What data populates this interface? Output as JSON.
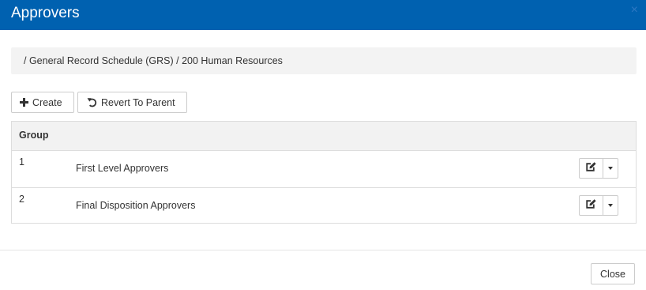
{
  "modal": {
    "title": "Approvers",
    "close_glyph": "×"
  },
  "breadcrumb": {
    "path": "/ General Record Schedule (GRS) / 200 Human Resources"
  },
  "toolbar": {
    "create_label": "Create",
    "revert_label": "Revert To Parent"
  },
  "table": {
    "columns": [
      "Group"
    ],
    "rows": [
      {
        "number": "1",
        "name": "First Level Approvers"
      },
      {
        "number": "2",
        "name": "Final Disposition Approvers"
      }
    ]
  },
  "footer": {
    "close_label": "Close"
  },
  "colors": {
    "header_bg": "#0061b0",
    "header_text": "#ffffff",
    "breadcrumb_bg": "#f3f3f3",
    "table_header_bg": "#f2f2f2",
    "border": "#dddddd"
  },
  "icons": {
    "create": "plus-icon",
    "revert": "undo-icon",
    "edit": "edit-icon",
    "dropdown": "caret-down-icon",
    "close": "close-icon"
  }
}
